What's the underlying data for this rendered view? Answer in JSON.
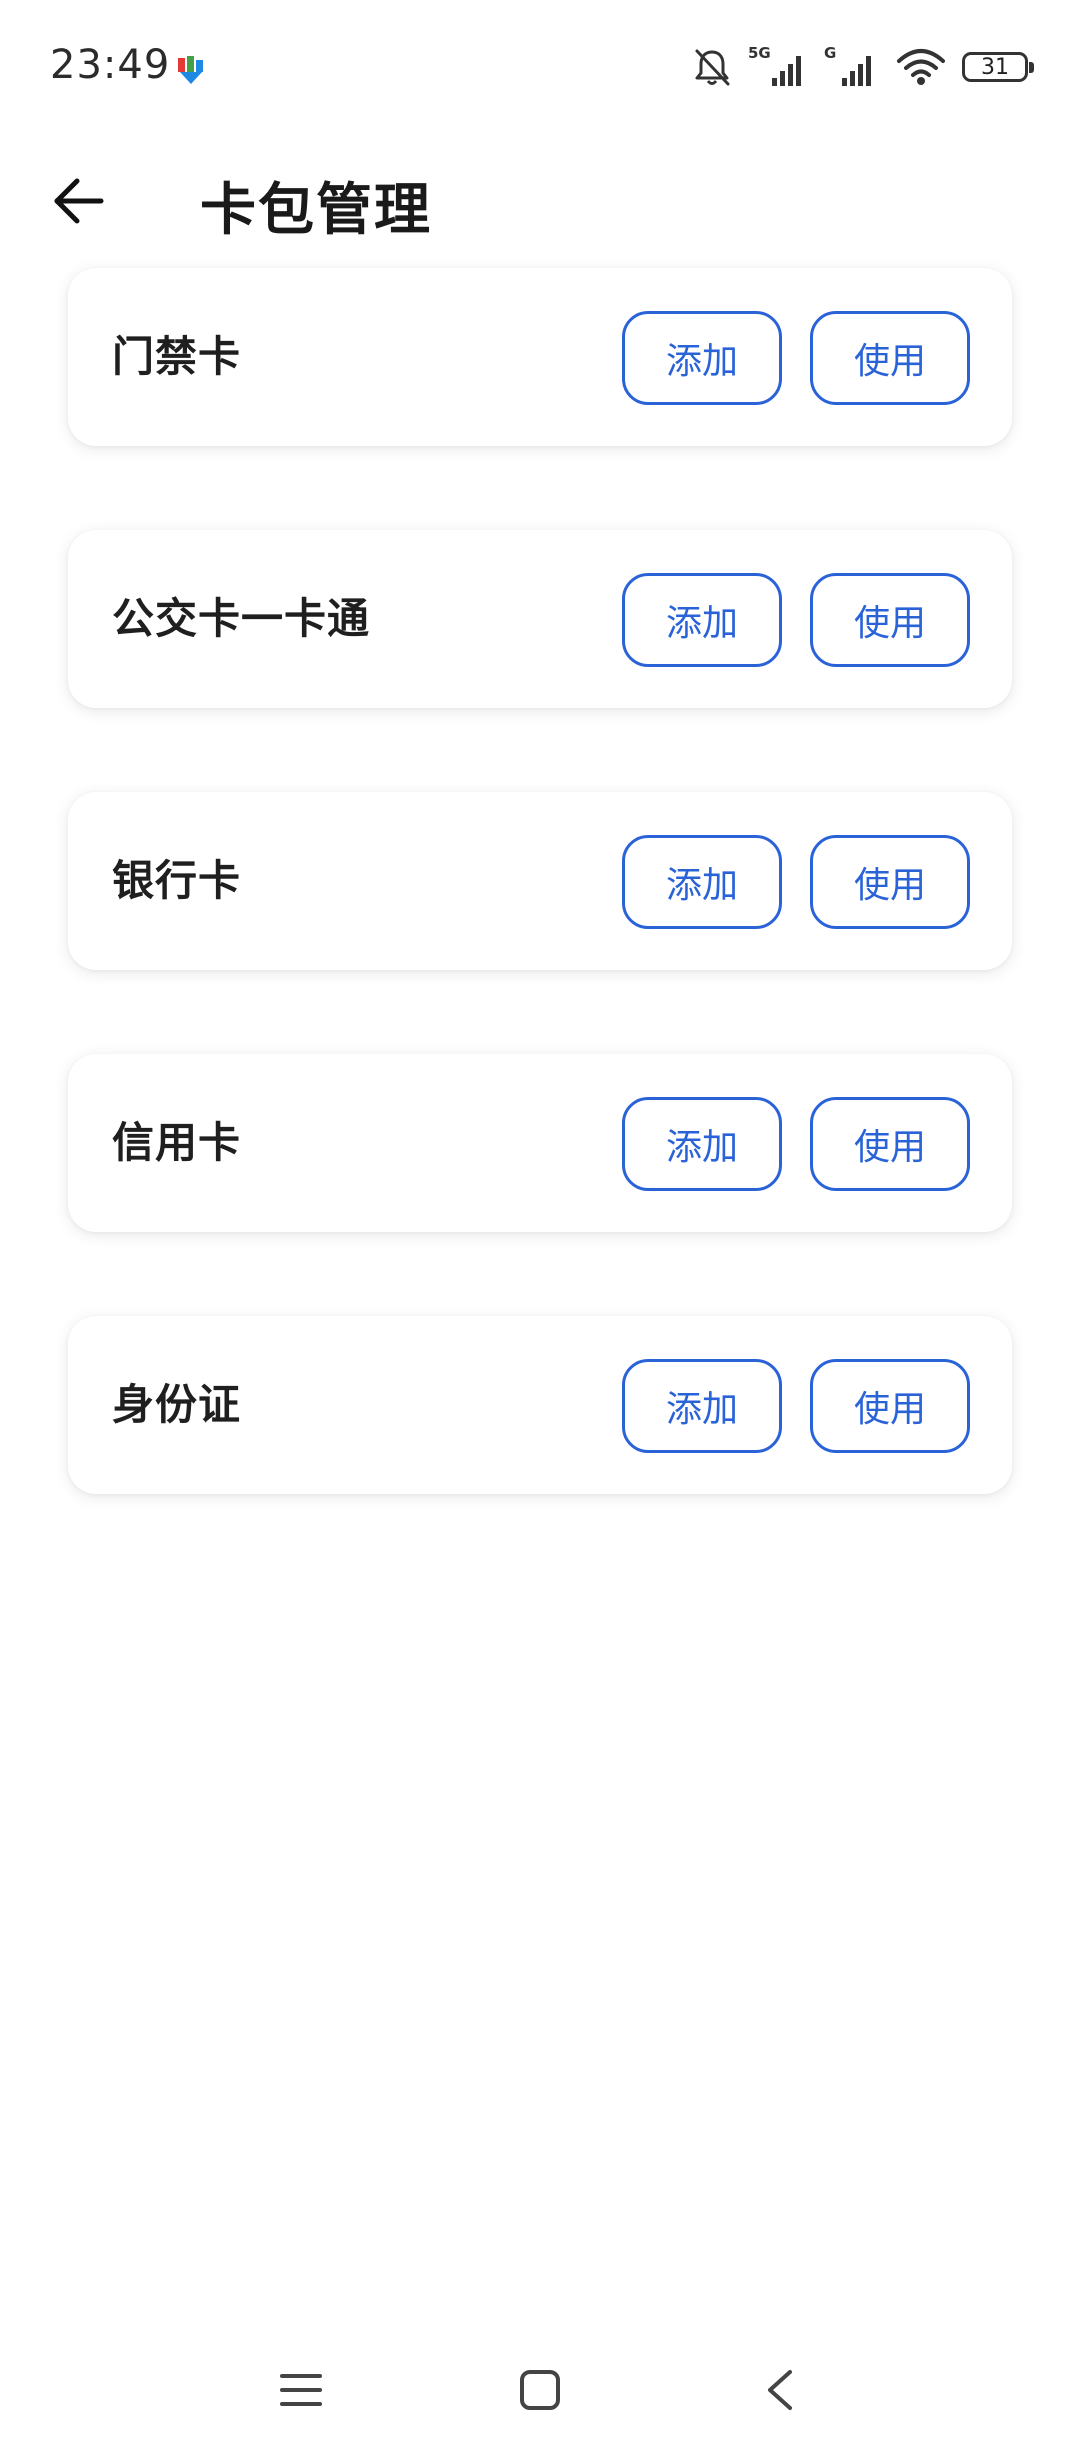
{
  "status_bar": {
    "time": "23:49",
    "battery_level": "31",
    "network_5g_label": "5G",
    "network_g_label": "G",
    "icons": [
      "notification-app-icon",
      "mute-bell-icon",
      "signal-5g-icon",
      "signal-g-icon",
      "wifi-icon",
      "battery-icon"
    ]
  },
  "header": {
    "title": "卡包管理",
    "back_icon": "arrow-left-icon"
  },
  "cards": [
    {
      "label": "门禁卡",
      "add_label": "添加",
      "use_label": "使用"
    },
    {
      "label": "公交卡一卡通",
      "add_label": "添加",
      "use_label": "使用"
    },
    {
      "label": "银行卡",
      "add_label": "添加",
      "use_label": "使用"
    },
    {
      "label": "信用卡",
      "add_label": "添加",
      "use_label": "使用"
    },
    {
      "label": "身份证",
      "add_label": "添加",
      "use_label": "使用"
    }
  ],
  "nav_bar": {
    "icons": [
      "menu-icon",
      "home-icon",
      "back-chevron-icon"
    ]
  },
  "colors": {
    "accent": "#2a63d8",
    "text": "#1a1a1a",
    "background": "#ffffff"
  }
}
